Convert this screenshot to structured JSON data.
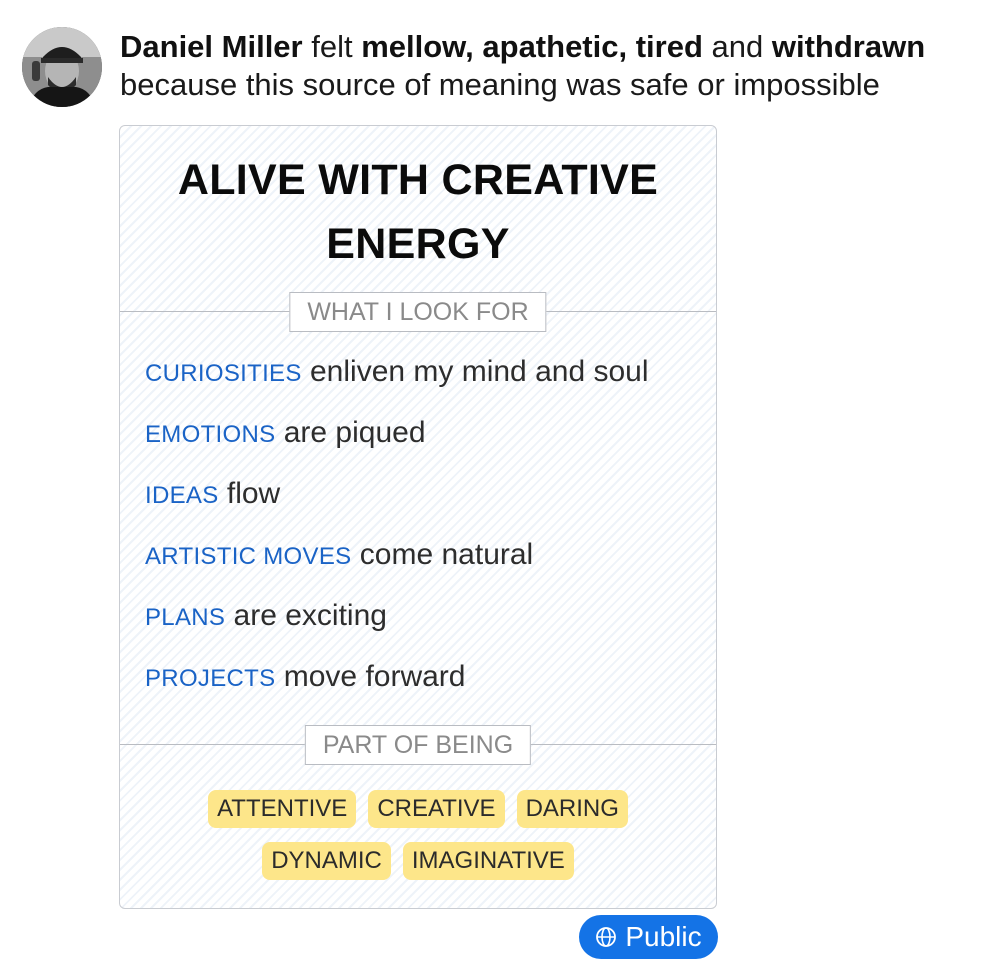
{
  "post": {
    "author": "Daniel Miller",
    "verb": "felt",
    "feelings": [
      "mellow",
      "apathetic",
      "tired",
      "withdrawn"
    ],
    "sep_comma": ", ",
    "sep_and": " and ",
    "reason": "because this source of meaning was safe or impossible",
    "avatar_icon": "person-photo"
  },
  "card": {
    "title": "ALIVE WITH CREATIVE ENERGY",
    "look_for_label": "WHAT I LOOK FOR",
    "items": [
      {
        "keyword": "CURIOSITIES",
        "text": " enliven my mind and soul"
      },
      {
        "keyword": "EMOTIONS",
        "text": " are piqued"
      },
      {
        "keyword": "IDEAS",
        "text": " flow"
      },
      {
        "keyword": "ARTISTIC MOVES",
        "text": " come natural"
      },
      {
        "keyword": "PLANS",
        "text": " are exciting"
      },
      {
        "keyword": "PROJECTS",
        "text": " move forward"
      }
    ],
    "part_of_being_label": "PART OF BEING",
    "tags": [
      "ATTENTIVE",
      "CREATIVE",
      "DARING",
      "DYNAMIC",
      "IMAGINATIVE"
    ]
  },
  "visibility": {
    "label": "Public",
    "icon": "globe-icon"
  },
  "colors": {
    "keyword": "#1a63c6",
    "chip": "#fde68a",
    "public_button": "#1473e6"
  }
}
